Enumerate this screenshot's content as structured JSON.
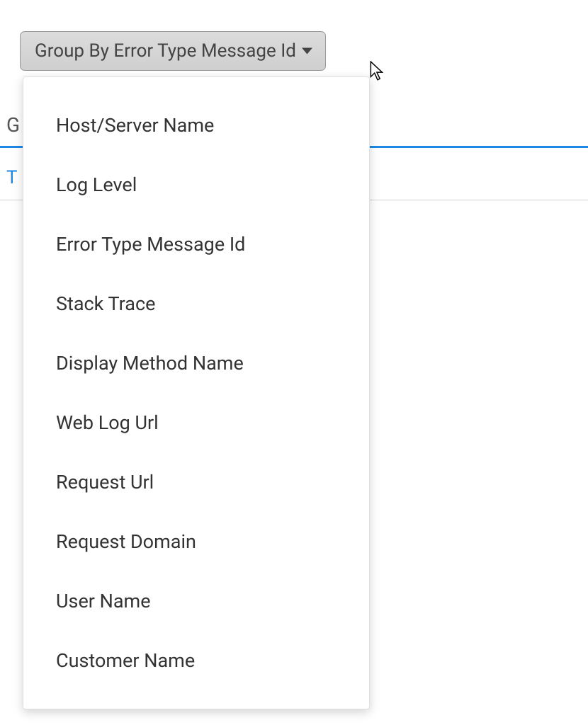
{
  "dropdown": {
    "button_label": "Group By Error Type Message Id",
    "options": [
      "Host/Server Name",
      "Log Level",
      "Error Type Message Id",
      "Stack Trace",
      "Display Method Name",
      "Web Log Url",
      "Request Url",
      "Request Domain",
      "User Name",
      "Customer Name"
    ]
  },
  "background": {
    "label_partial": "G",
    "tab_partial": "T"
  }
}
